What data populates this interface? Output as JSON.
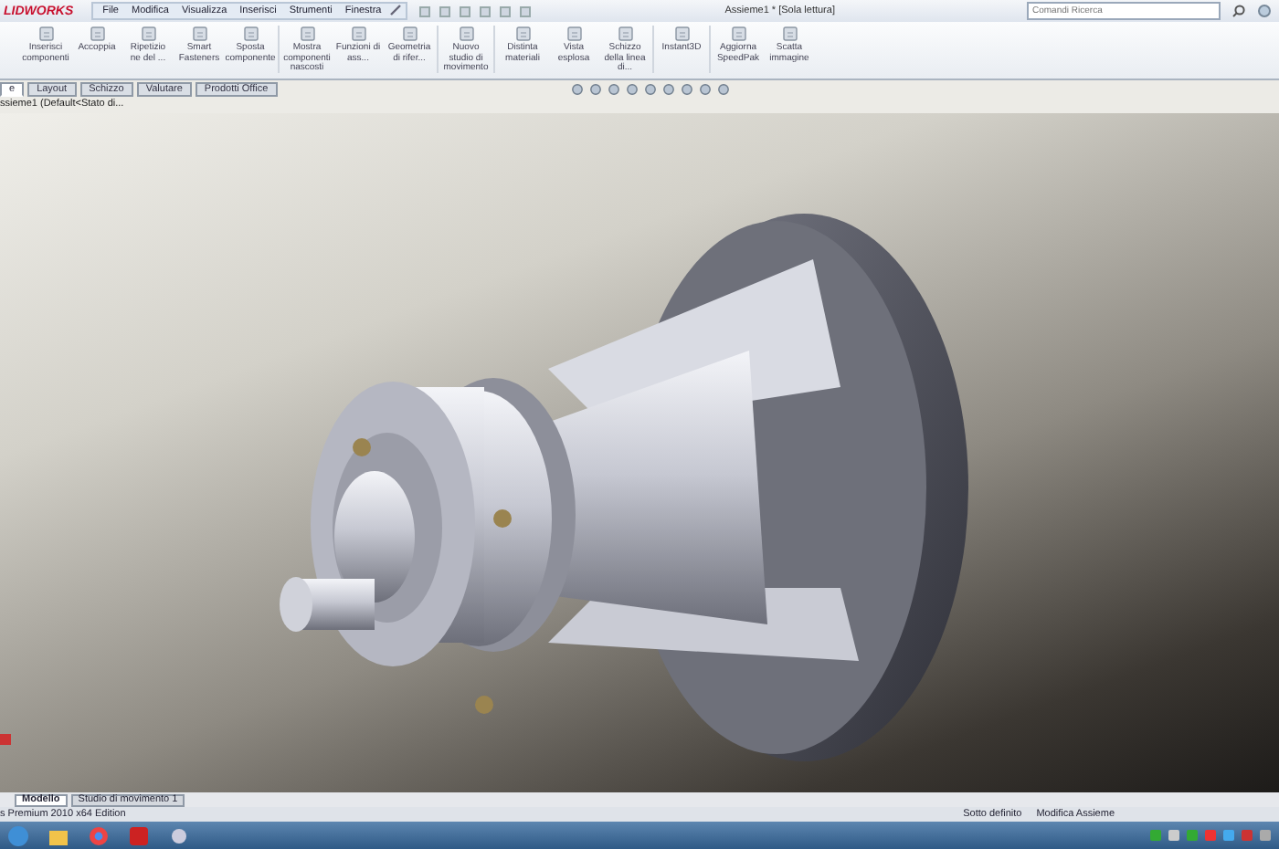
{
  "app": {
    "logo": "LIDWORKS",
    "menus": [
      "File",
      "Modifica",
      "Visualizza",
      "Inserisci",
      "Strumenti",
      "Finestra"
    ],
    "title": "Assieme1 * [Sola lettura]",
    "search": {
      "placeholder": "Comandi Ricerca"
    }
  },
  "ribbon": {
    "commands": [
      {
        "label": "Inserisci componenti"
      },
      {
        "label": "Accoppia"
      },
      {
        "label": "Ripetizio ne del ..."
      },
      {
        "label": "Smart Fasteners"
      },
      {
        "label": "Sposta componente"
      },
      {
        "label": "Mostra componenti nascosti"
      },
      {
        "label": "Funzioni di ass..."
      },
      {
        "label": "Geometria di rifer..."
      },
      {
        "label": "Nuovo studio di movimento"
      },
      {
        "label": "Distinta materiali"
      },
      {
        "label": "Vista esplosa"
      },
      {
        "label": "Schizzo della linea di..."
      },
      {
        "label": "Instant3D"
      },
      {
        "label": "Aggiorna SpeedPak"
      },
      {
        "label": "Scatta immagine"
      }
    ]
  },
  "command_tabs": [
    {
      "label": "e",
      "selected": true
    },
    {
      "label": "Layout",
      "selected": false
    },
    {
      "label": "Schizzo",
      "selected": false
    },
    {
      "label": "Valutare",
      "selected": false
    },
    {
      "label": "Prodotti Office",
      "selected": false
    }
  ],
  "tree": {
    "root": "ssieme1 (Default<Stato di..."
  },
  "view_tabs": [
    {
      "label": "Modello",
      "selected": true
    },
    {
      "label": "Studio di movimento 1",
      "selected": false
    }
  ],
  "status_bar": {
    "product": "s Premium 2010 x64 Edition",
    "state": "Sotto definito",
    "mode": "Modifica Assieme"
  }
}
